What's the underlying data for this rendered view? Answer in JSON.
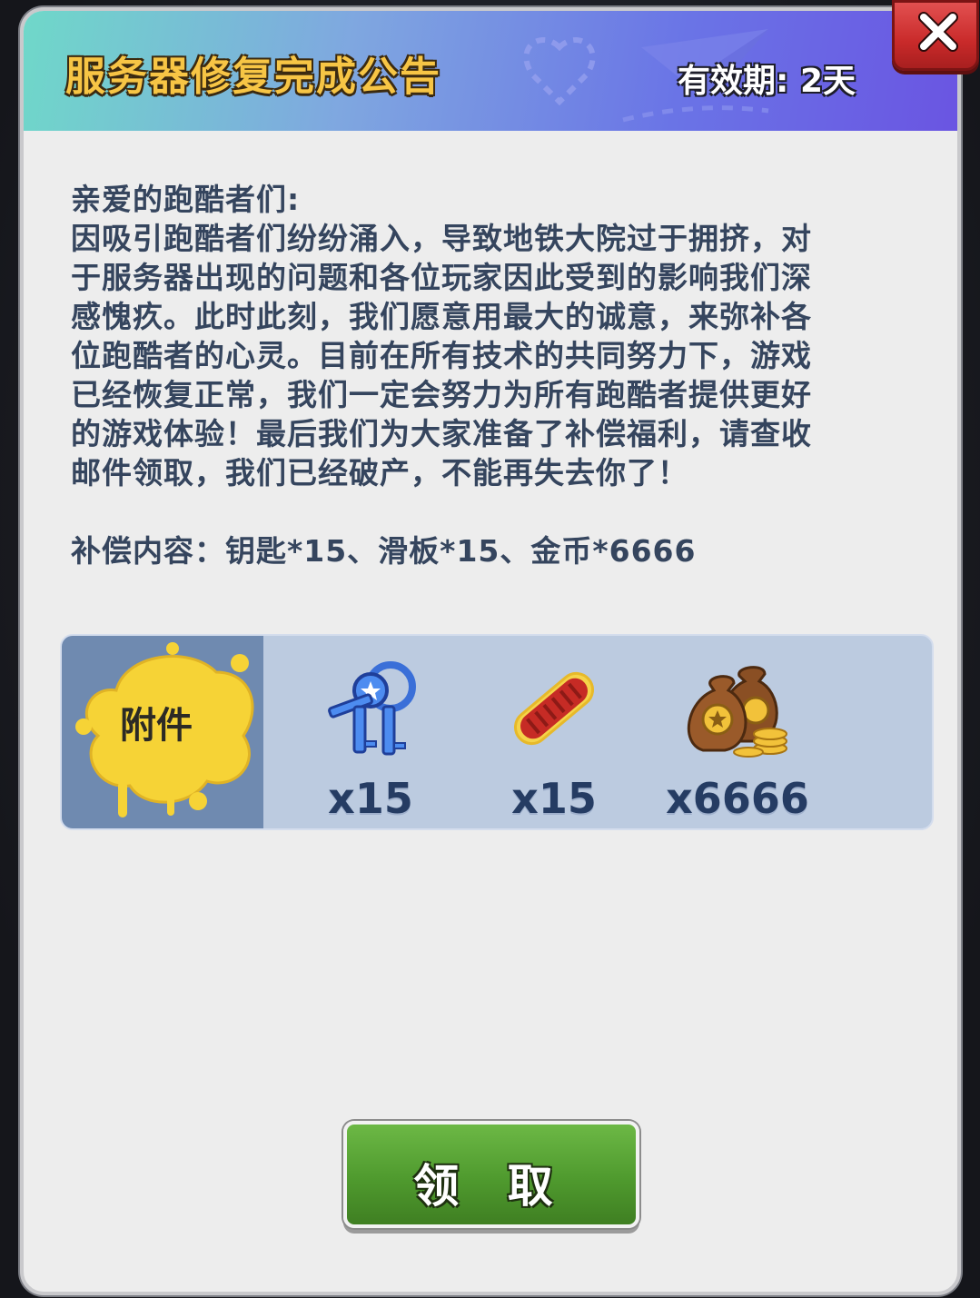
{
  "dialog": {
    "title": "服务器修复完成公告",
    "validity": "有效期: 2天",
    "close_icon": "close-x-icon"
  },
  "message": {
    "greeting": "亲爱的跑酷者们:",
    "lines": [
      "因吸引跑酷者们纷纷涌入，导致地铁大院过于拥挤，对",
      "于服务器出现的问题和各位玩家因此受到的影响我们深",
      "感愧疚。此时此刻，我们愿意用最大的诚意，来弥补各",
      "位跑酷者的心灵。目前在所有技术的共同努力下，游戏",
      "已经恢复正常，我们一定会努力为所有跑酷者提供更好",
      "的游戏体验！最后我们为大家准备了补偿福利，请查收",
      "邮件领取，我们已经破产，不能再失去你了！"
    ],
    "compensation": "补偿内容：钥匙*15、滑板*15、金币*6666"
  },
  "attachments": {
    "label": "附件",
    "items": [
      {
        "icon": "keys-icon",
        "quantity": "x15"
      },
      {
        "icon": "hoverboard-icon",
        "quantity": "x15"
      },
      {
        "icon": "coin-bags-icon",
        "quantity": "x6666"
      }
    ]
  },
  "claim_button": {
    "label": "领 取",
    "color": "#52a032"
  }
}
